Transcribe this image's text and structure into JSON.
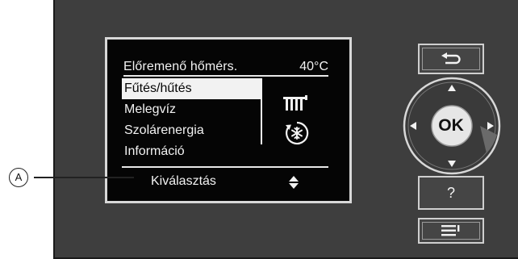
{
  "screen": {
    "header_label": "Előremenő hőmérs.",
    "header_value": "40°C",
    "menu_items": [
      "Fűtés/hűtés",
      "Melegvíz",
      "Szolárenergia",
      "Információ"
    ],
    "selected_index": 0,
    "footer_label": "Kiválasztás"
  },
  "callout": {
    "label": "A"
  },
  "controls": {
    "ok_label": "OK",
    "help_label": "?"
  },
  "icons": {
    "radiator": "radiator-icon",
    "heat_cool": "snowflake-cycle-icon",
    "scroll": "up-down-arrows-icon",
    "back": "back-arrow-icon",
    "menu": "menu-icon"
  }
}
